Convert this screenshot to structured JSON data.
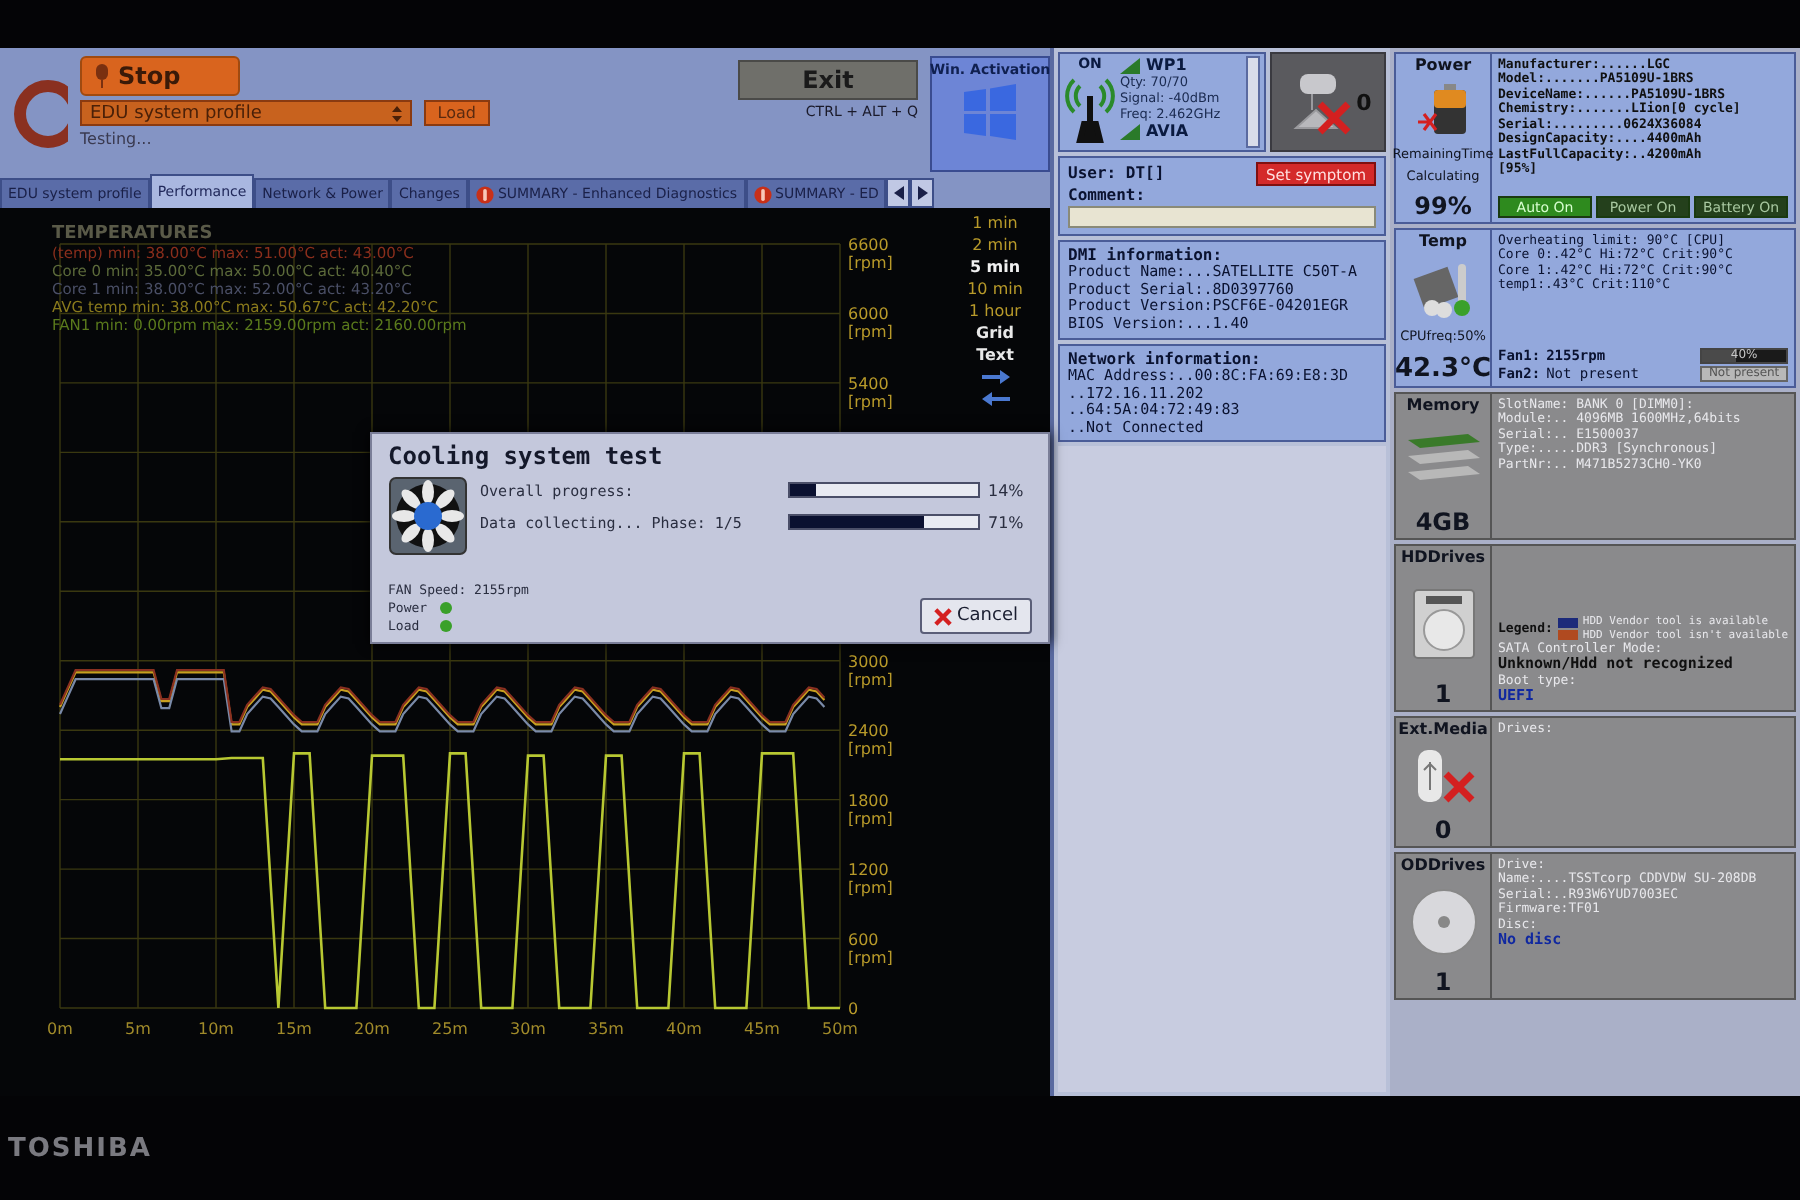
{
  "header": {
    "stop_button": "Stop",
    "profile_select": "EDU system profile",
    "load_button": "Load",
    "status": "Testing...",
    "exit_button": "Exit",
    "exit_shortcut": "CTRL + ALT + Q",
    "activation_title": "Win. Activation"
  },
  "tabs": [
    {
      "label": "EDU system profile",
      "selected": false,
      "kind": "plain"
    },
    {
      "label": "Performance",
      "selected": true,
      "kind": "plain"
    },
    {
      "label": "Network & Power",
      "selected": false,
      "kind": "plain"
    },
    {
      "label": "Changes",
      "selected": false,
      "kind": "plain"
    },
    {
      "label": "SUMMARY - Enhanced Diagnostics",
      "selected": false,
      "kind": "summary"
    },
    {
      "label": "SUMMARY - ED",
      "selected": false,
      "kind": "summary"
    }
  ],
  "performance": {
    "legend_title": "TEMPERATURES",
    "legend": [
      {
        "text": "(temp) min: 38.00°C max: 51.00°C act: 43.00°C",
        "color": "#8a2e1c"
      },
      {
        "text": "Core 0 min: 35.00°C max: 50.00°C act: 40.40°C",
        "color": "#5c6a3a"
      },
      {
        "text": "Core 1 min: 38.00°C max: 52.00°C act: 43.20°C",
        "color": "#4a4f66"
      },
      {
        "text": "AVG temp min: 38.00°C max: 50.67°C act: 42.20°C",
        "color": "#8a7a1c"
      }
    ],
    "fan_stats": "min: 0.00rpm max: 2159.00rpm act: 2160.00rpm",
    "range_options": [
      {
        "label": "1 min",
        "selected": false
      },
      {
        "label": "2 min",
        "selected": false
      },
      {
        "label": "5 min",
        "selected": true
      },
      {
        "label": "10 min",
        "selected": false
      },
      {
        "label": "1 hour",
        "selected": false
      }
    ],
    "toggles": [
      {
        "label": "Grid",
        "on": true
      },
      {
        "label": "Text",
        "on": true
      }
    ],
    "chart_data": {
      "type": "line",
      "grid": true,
      "x": [
        0,
        1,
        2,
        3,
        4,
        5,
        6,
        7,
        8,
        9,
        10,
        11,
        12,
        13,
        14,
        15,
        16,
        17,
        18,
        19,
        20,
        21,
        22,
        23,
        24,
        25,
        26,
        27,
        28,
        29,
        30,
        31,
        32,
        33,
        34,
        35,
        36,
        37,
        38,
        39,
        40,
        41,
        42,
        43,
        44,
        45,
        46,
        47,
        48,
        49,
        50
      ],
      "xlim": [
        0,
        50
      ],
      "ylim": [
        0,
        6600
      ],
      "xticks": [
        {
          "value": 0,
          "label": "0m"
        },
        {
          "value": 5,
          "label": "5m"
        },
        {
          "value": 10,
          "label": "10m"
        },
        {
          "value": 15,
          "label": "15m"
        },
        {
          "value": 20,
          "label": "20m"
        },
        {
          "value": 25,
          "label": "25m"
        },
        {
          "value": 30,
          "label": "30m"
        },
        {
          "value": 35,
          "label": "35m"
        },
        {
          "value": 40,
          "label": "40m"
        },
        {
          "value": 45,
          "label": "45m"
        },
        {
          "value": 50,
          "label": "50m"
        }
      ],
      "yticks": [
        {
          "value": 0,
          "label": "0"
        },
        {
          "value": 600,
          "label": "600 [rpm]"
        },
        {
          "value": 1200,
          "label": "1200 [rpm]"
        },
        {
          "value": 1800,
          "label": "1800 [rpm]"
        },
        {
          "value": 2400,
          "label": "2400 [rpm]"
        },
        {
          "value": 3000,
          "label": "3000 [rpm]"
        },
        {
          "value": 5400,
          "label": "5400 [rpm]"
        },
        {
          "value": 6000,
          "label": "6000 [rpm]"
        },
        {
          "value": 6600,
          "label": "6600 [rpm]"
        }
      ],
      "series": [
        {
          "name": "FAN1",
          "color": "#b8c832",
          "values": [
            2150,
            2150,
            2150,
            2150,
            2150,
            2150,
            2150,
            2150,
            2150,
            2150,
            2150,
            2160,
            2160,
            2160,
            0,
            2200,
            2200,
            0,
            0,
            0,
            2180,
            2180,
            2180,
            0,
            0,
            2200,
            2200,
            0,
            0,
            0,
            2180,
            2180,
            0,
            0,
            0,
            2180,
            2180,
            0,
            0,
            0,
            2200,
            2200,
            0,
            0,
            0,
            2200,
            2200,
            2200,
            0,
            0,
            0
          ]
        }
      ]
    }
  },
  "wifi": {
    "state": "ON",
    "networks": [
      {
        "name": "WP1",
        "details": [
          "Qty: 70/70",
          "Signal: -40dBm",
          "Freq: 2.462GHz"
        ]
      },
      {
        "name": "AVIA"
      }
    ]
  },
  "webcam": {
    "count": "0"
  },
  "user": {
    "user": "User: DT[]",
    "set_symptom_button": "Set symptom",
    "comment_label": "Comment:"
  },
  "dmi": {
    "title": "DMI information:",
    "lines": [
      "Product Name:...SATELLITE C50T-A",
      "Product Serial:.8D0397760",
      "Product Version:PSCF6E-04201EGR",
      "BIOS Version:...1.40"
    ]
  },
  "network": {
    "title": "Network information:",
    "lines": [
      "MAC Address:..00:8C:FA:69:E8:3D",
      "..172.16.11.202",
      "..64:5A:04:72:49:83",
      "..Not Connected"
    ]
  },
  "power": {
    "title": "Power",
    "remaining_label": "RemainingTime",
    "remaining_value": "Calculating",
    "charge": "99%",
    "info": [
      "Manufacturer:......LGC",
      "Model:.......PA5109U-1BRS",
      "DeviceName:......PA5109U-1BRS",
      "Chemistry:.......LIion[0 cycle]",
      "Serial:.........0624X36084",
      "DesignCapacity:....4400mAh",
      "LastFullCapacity:..4200mAh",
      "[95%]"
    ],
    "modes": [
      {
        "label": "Auto On",
        "selected": true
      },
      {
        "label": "Power On",
        "selected": false
      },
      {
        "label": "Battery On",
        "selected": false
      }
    ]
  },
  "temp": {
    "title": "Temp",
    "cpu_freq": "CPUfreq:50%",
    "value": "42.3°C",
    "info": [
      "Overheating limit: 90°C [CPU]",
      "Core 0:.42°C Hi:72°C Crit:90°C",
      "Core 1:.42°C Hi:72°C Crit:90°C",
      "temp1:.43°C Crit:110°C"
    ],
    "fans": [
      {
        "label": "Fan1:",
        "value": "2155rpm",
        "kind": "meter",
        "level": 0.4,
        "reading": "40%"
      },
      {
        "label": "Fan2:",
        "value": "Not present",
        "kind": "absent",
        "reading": "Not present"
      }
    ]
  },
  "memory": {
    "title": "Memory",
    "size": "4GB",
    "info": [
      {
        "text": "SlotName: BANK 0 [DIMM0]:",
        "kind": "label"
      },
      {
        "text": "Module:.. 4096MB 1600MHz,64bits",
        "kind": "label"
      },
      {
        "text": "Serial:.. E1500037",
        "kind": "label"
      },
      {
        "text": "Type:.....DDR3 [Synchronous]",
        "kind": "label"
      },
      {
        "text": "PartNr:.. M471B5273CH0-YK0",
        "kind": "label"
      }
    ]
  },
  "hdd": {
    "title": "HDDrives",
    "count": "1",
    "legend_label": "Legend:",
    "legend": [
      {
        "text": "HDD Vendor tool is available",
        "color": "#1c2a7a"
      },
      {
        "text": "HDD Vendor tool isn't available",
        "color": "#b04a20"
      }
    ],
    "info": [
      {
        "text": "SATA Controller Mode:",
        "kind": "label"
      },
      {
        "text": "Unknown/Hdd not recognized",
        "kind": "value"
      },
      {
        "text": "Boot type:",
        "kind": "label"
      },
      {
        "text": "UEFI",
        "kind": "highlight"
      }
    ]
  },
  "ext_media": {
    "title": "Ext.Media",
    "count": "0",
    "info": [
      {
        "text": "Drives:",
        "kind": "label"
      }
    ]
  },
  "optical": {
    "title": "ODDrives",
    "count": "1",
    "info": [
      {
        "text": "Drive:",
        "kind": "label"
      },
      {
        "text": "Name:....TSSTcorp CDDVDW SU-208DB",
        "kind": "label"
      },
      {
        "text": "Serial:..R93W6YUD7003EC",
        "kind": "label"
      },
      {
        "text": "Firmware:TF01",
        "kind": "label"
      },
      {
        "text": "Disc:",
        "kind": "label"
      },
      {
        "text": "No disc",
        "kind": "highlight"
      }
    ]
  },
  "dialog": {
    "title": "Cooling system test",
    "progress": [
      {
        "label": "Overall progress:",
        "level": 0.14,
        "reading": "14%"
      },
      {
        "label": "Data collecting... Phase: 1/5",
        "level": 0.71,
        "reading": "71%"
      }
    ],
    "fan_speed": "FAN Speed: 2155rpm",
    "indicators": [
      {
        "label": "Power",
        "on": true
      },
      {
        "label": "Load",
        "on": true
      }
    ],
    "cancel_button": "Cancel"
  },
  "bezel_brand": "TOSHIBA"
}
